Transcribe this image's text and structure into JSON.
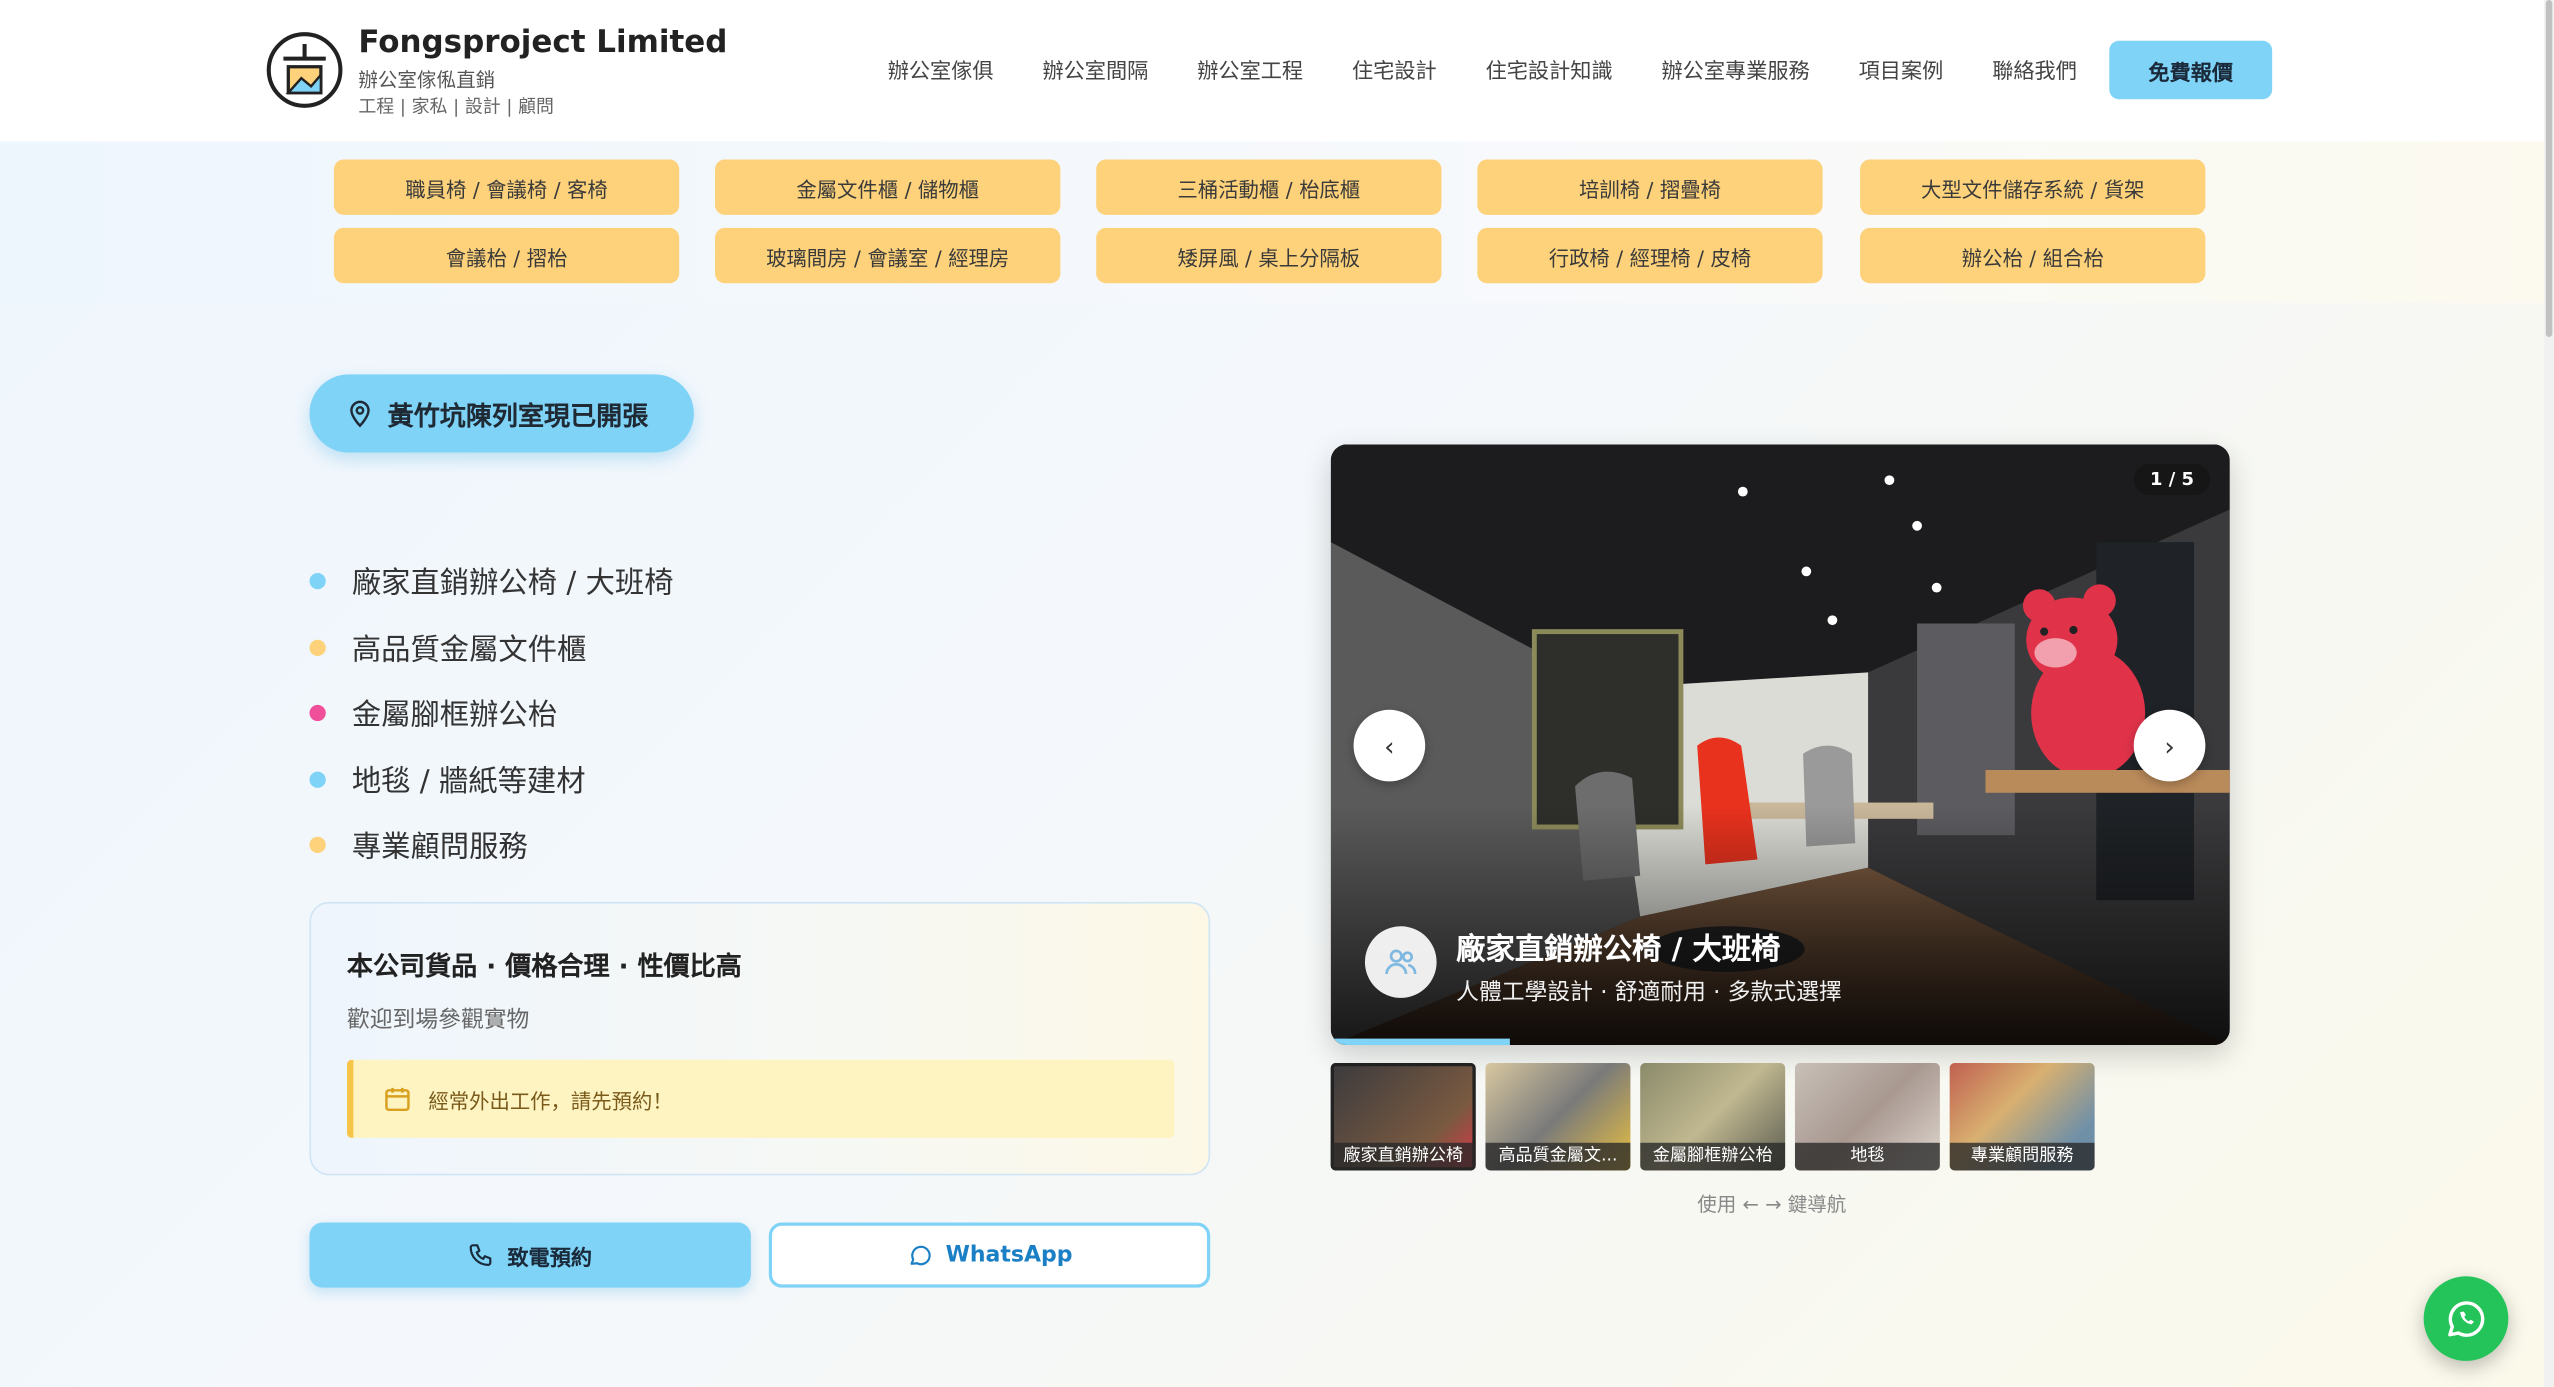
{
  "header": {
    "brand_name": "Fongsproject Limited",
    "brand_sub": "辦公室傢俬直銷",
    "brand_tag": "工程 | 家私 | 設計 | 顧問",
    "nav": [
      "辦公室傢俱",
      "辦公室間隔",
      "辦公室工程",
      "住宅設計",
      "住宅設計知識",
      "辦公室專業服務",
      "項目案例",
      "聯絡我們"
    ],
    "quote_label": "免費報價"
  },
  "categories": [
    "職員椅 / 會議椅 / 客椅",
    "金屬文件櫃 / 儲物櫃",
    "三桶活動櫃 / 枱底櫃",
    "培訓椅 / 摺疊椅",
    "大型文件儲存系統 / 貨架",
    "會議枱 / 摺枱",
    "玻璃間房 / 會議室 / 經理房",
    "矮屏風 / 桌上分隔板",
    "行政椅 / 經理椅 / 皮椅",
    "辦公枱 / 組合枱"
  ],
  "badge": "黃竹坑陳列室現已開張",
  "features": [
    {
      "label": "廠家直銷辦公椅 / 大班椅",
      "color": "#7fd3f7"
    },
    {
      "label": "高品質金屬文件櫃",
      "color": "#fdd27a"
    },
    {
      "label": "金屬腳框辦公枱",
      "color": "#f0509a"
    },
    {
      "label": "地毯 / 牆紙等建材",
      "color": "#7fd3f7"
    },
    {
      "label": "專業顧問服務",
      "color": "#fdd27a"
    }
  ],
  "info": {
    "title": "本公司貨品 · 價格合理 · 性價比高",
    "subtitle": "歡迎到場參觀實物",
    "notice": "經常外出工作，請先預約！"
  },
  "buttons": {
    "call": "致電預約",
    "whatsapp": "WhatsApp"
  },
  "slider": {
    "counter": "1 / 5",
    "caption_title": "廠家直銷辦公椅 / 大班椅",
    "caption_sub": "人體工學設計 · 舒適耐用 · 多款式選擇",
    "progress": 0.2,
    "thumbs": [
      "廠家直銷辦公椅",
      "高品質金屬文...",
      "金屬腳框辦公枱",
      "地毯",
      "專業顧問服務"
    ],
    "hint": "使用 ← → 鍵導航"
  }
}
